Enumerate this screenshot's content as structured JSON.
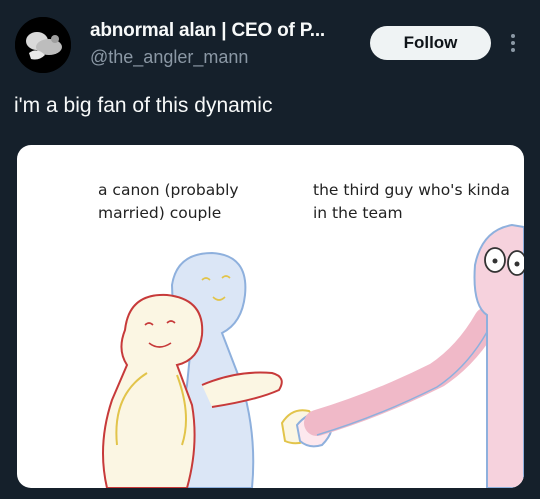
{
  "author": {
    "display_name": "abnormal alan | CEO of P...",
    "handle": "@the_angler_mann"
  },
  "follow_label": "Follow",
  "tweet_text": "i'm a big fan of this dynamic",
  "media": {
    "caption_left": "a canon (probably married) couple",
    "caption_right": "the third guy who's kinda in the team"
  },
  "colors": {
    "background": "#15202b",
    "follow_button": "#eff3f4",
    "red_character": "#e8c84a",
    "blue_character": "#cfe0f5",
    "pink_character": "#f4c9d6"
  }
}
